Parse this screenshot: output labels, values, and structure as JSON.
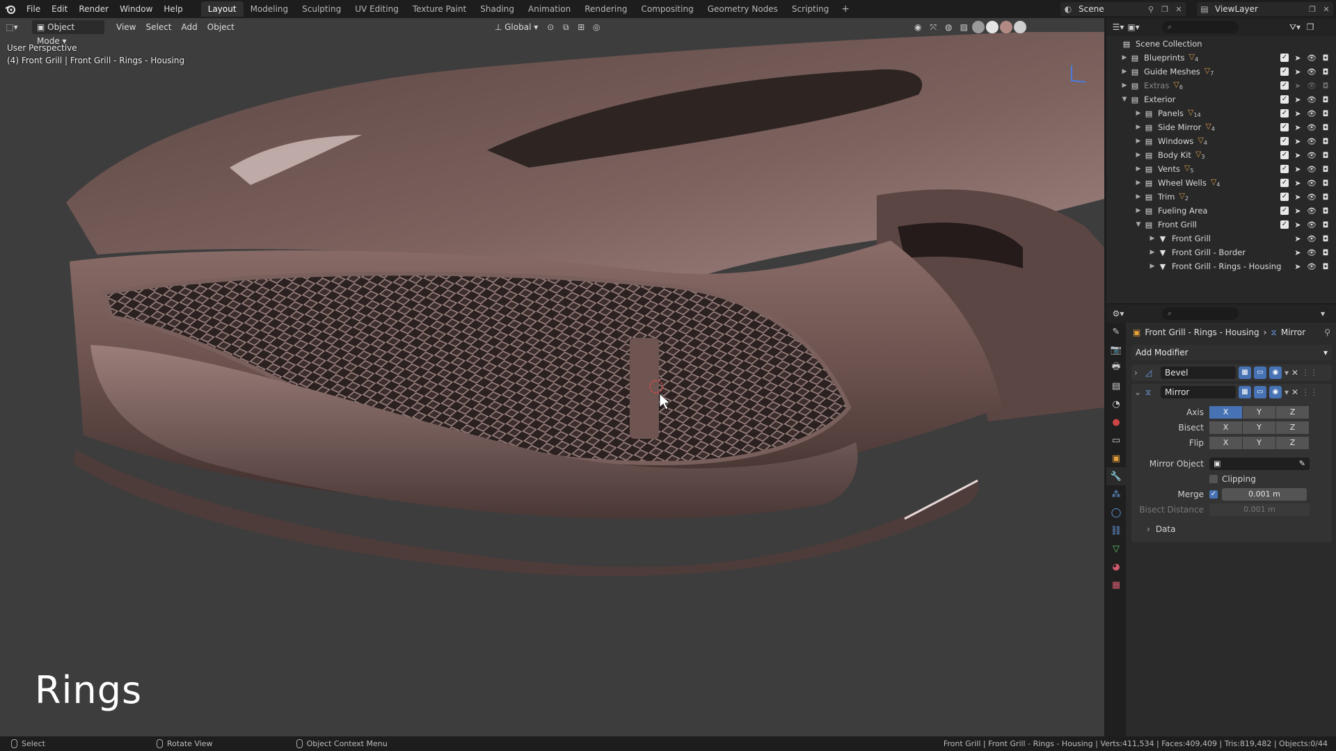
{
  "menu": {
    "items": [
      "File",
      "Edit",
      "Render",
      "Window",
      "Help"
    ]
  },
  "workspaces": {
    "tabs": [
      "Layout",
      "Modeling",
      "Sculpting",
      "UV Editing",
      "Texture Paint",
      "Shading",
      "Animation",
      "Rendering",
      "Compositing",
      "Geometry Nodes",
      "Scripting"
    ],
    "active": "Layout",
    "add_symbol": "+"
  },
  "scene": {
    "name": "Scene"
  },
  "view_layer": {
    "name": "ViewLayer"
  },
  "viewport": {
    "mode": "Object Mode",
    "menus": [
      "View",
      "Select",
      "Add",
      "Object"
    ],
    "transform_orientation": "Global",
    "perspective_label": "User Perspective",
    "object_info": "(4) Front Grill | Front Grill - Rings - Housing",
    "caption": "Rings",
    "colors": {
      "background": "#3d3d3d",
      "car_body": "#6e5450",
      "grill": "#2a2120"
    }
  },
  "outliner": {
    "search_placeholder": "",
    "root": "Scene Collection",
    "rows": [
      {
        "label": "Blueprints",
        "badge": "4",
        "dim": false,
        "indent": 1
      },
      {
        "label": "Guide Meshes",
        "badge": "7",
        "dim": false,
        "indent": 1
      },
      {
        "label": "Extras",
        "badge": "6",
        "dim": true,
        "indent": 1
      },
      {
        "label": "Exterior",
        "badge": "",
        "dim": false,
        "indent": 1
      },
      {
        "label": "Panels",
        "badge": "14",
        "dim": false,
        "indent": 2
      },
      {
        "label": "Side Mirror",
        "badge": "4",
        "dim": false,
        "indent": 2
      },
      {
        "label": "Windows",
        "badge": "4",
        "dim": false,
        "indent": 2
      },
      {
        "label": "Body Kit",
        "badge": "3",
        "dim": false,
        "indent": 2
      },
      {
        "label": "Vents",
        "badge": "5",
        "dim": false,
        "indent": 2
      },
      {
        "label": "Wheel Wells",
        "badge": "4",
        "dim": false,
        "indent": 2
      },
      {
        "label": "Trim",
        "badge": "2",
        "dim": false,
        "indent": 2
      },
      {
        "label": "Fueling Area",
        "badge": "",
        "dim": false,
        "indent": 2
      },
      {
        "label": "Front Grill",
        "badge": "",
        "dim": false,
        "indent": 2
      },
      {
        "label": "Front Grill",
        "badge": "",
        "dim": false,
        "indent": 3
      },
      {
        "label": "Front Grill - Border",
        "badge": "",
        "dim": false,
        "indent": 3
      },
      {
        "label": "Front Grill - Rings - Housing",
        "badge": "",
        "dim": false,
        "indent": 3
      }
    ]
  },
  "properties": {
    "object_name": "Front Grill - Rings - Housing",
    "context": "Mirror",
    "add_modifier": "Add Modifier",
    "modifiers": [
      {
        "name": "Bevel",
        "expanded": false
      },
      {
        "name": "Mirror",
        "expanded": true
      }
    ],
    "mirror": {
      "axis_label": "Axis",
      "bisect_label": "Bisect",
      "flip_label": "Flip",
      "axes": [
        "X",
        "Y",
        "Z"
      ],
      "axis_active": [
        true,
        false,
        false
      ],
      "mirror_object_label": "Mirror Object",
      "clipping_label": "Clipping",
      "merge_label": "Merge",
      "merge_value": "0.001 m",
      "bisect_distance_label": "Bisect Distance",
      "bisect_distance_value": "0.001 m",
      "data_label": "Data"
    }
  },
  "statusbar": {
    "select": "Select",
    "rotate": "Rotate View",
    "context_menu": "Object Context Menu",
    "stats": "Front Grill | Front Grill - Rings - Housing | Verts:411,534 | Faces:409,409 | Tris:819,482 | Objects:0/44"
  }
}
